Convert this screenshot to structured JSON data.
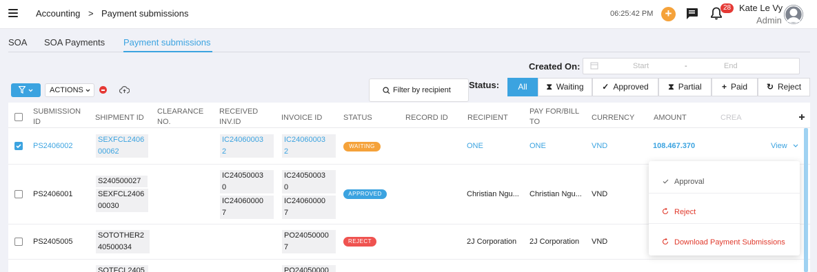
{
  "header": {
    "breadcrumb": [
      "Accounting",
      ">",
      "Payment submissions"
    ],
    "time": "06:25:42 PM",
    "notification_count": "28",
    "user_name": "Kate Le Vy",
    "user_role": "Admin"
  },
  "tabs": [
    {
      "label": "SOA"
    },
    {
      "label": "SOA Payments"
    },
    {
      "label": "Payment submissions",
      "active": true
    }
  ],
  "filters": {
    "created_on_label": "Created On:",
    "date_start_placeholder": "Start",
    "date_sep": "-",
    "date_end_placeholder": "End",
    "actions_label": "ACTIONS",
    "filter_by_recipient": "Filter by recipient",
    "status_label": "Status:",
    "status_options": [
      "All",
      "Waiting",
      "Approved",
      "Partial",
      "Paid",
      "Reject"
    ],
    "status_selected": "All"
  },
  "table": {
    "columns": [
      "SUBMISSION ID",
      "SHIPMENT ID",
      "CLEARANCE NO.",
      "RECEIVED INV.ID",
      "INVOICE ID",
      "STATUS",
      "RECORD ID",
      "RECIPIENT",
      "PAY FOR/BILL TO",
      "CURRENCY",
      "AMOUNT",
      "CREA"
    ],
    "rows": [
      {
        "checked": true,
        "submission_id": "PS2406002",
        "shipment_ids": [
          [
            "SEXFCL2406",
            "00062"
          ]
        ],
        "received_inv_ids": [
          [
            "IC24060003",
            "2"
          ]
        ],
        "invoice_ids": [
          [
            "IC24060003",
            "2"
          ]
        ],
        "status": "WAITING",
        "recipient": "ONE",
        "pay_for": "ONE",
        "currency": "VND",
        "amount": "108.467.370",
        "action": "View"
      },
      {
        "checked": false,
        "submission_id": "PS2406001",
        "shipment_ids": [
          [
            "S240500027"
          ],
          [
            "SEXFCL2406",
            "00030"
          ]
        ],
        "received_inv_ids": [
          [
            "IC24050003",
            "0"
          ],
          [
            "IC24060000",
            "7"
          ]
        ],
        "invoice_ids": [
          [
            "IC24050003",
            "0"
          ],
          [
            "IC24060000",
            "7"
          ]
        ],
        "status": "APPROVED",
        "recipient": "Christian Ngu...",
        "pay_for": "Christian Ngu...",
        "currency": "VND"
      },
      {
        "checked": false,
        "submission_id": "PS2405005",
        "shipment_ids": [
          [
            "SOTOTHER2",
            "40500034"
          ]
        ],
        "received_inv_ids": [],
        "invoice_ids": [
          [
            "PO24050000",
            "7"
          ]
        ],
        "status": "REJECT",
        "recipient": "2J Corporation",
        "pay_for": "2J Corporation",
        "currency": "VND"
      },
      {
        "partial": true,
        "shipment_ids": [
          [
            "SOTFCL2405"
          ]
        ],
        "invoice_ids": [
          [
            "PO24050000"
          ]
        ]
      }
    ]
  },
  "status_colors": {
    "WAITING": "#f5a23a",
    "APPROVED": "#3ba3e0",
    "REJECT": "#ef5350"
  },
  "row_menu": {
    "items": [
      {
        "label": "Approval"
      },
      {
        "label": "Reject"
      },
      {
        "label": "Download Payment Submissions"
      }
    ]
  },
  "icons": [
    "menu-icon",
    "plus-icon",
    "chat-icon",
    "bell-icon",
    "avatar-icon",
    "calendar-icon",
    "filter-icon",
    "chevron-down-icon",
    "cloud-upload-icon",
    "search-icon",
    "hourglass-icon",
    "check-icon",
    "refresh-icon"
  ]
}
